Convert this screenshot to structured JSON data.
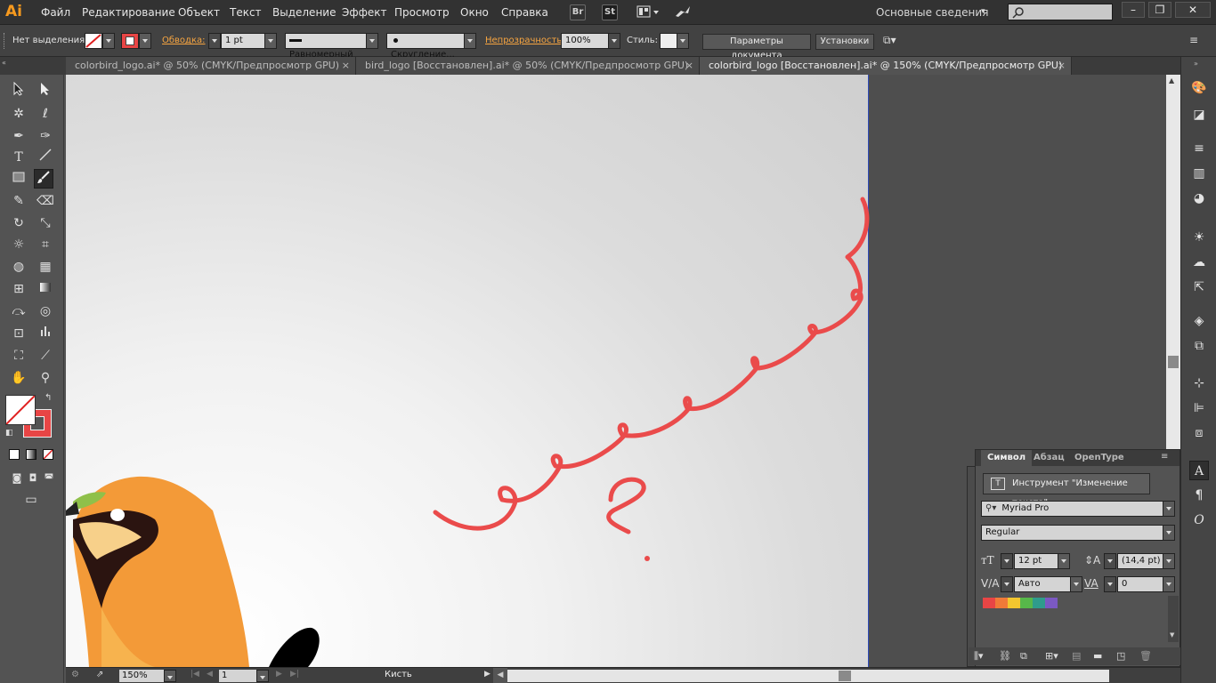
{
  "app": {
    "logo": "Ai"
  },
  "menu": {
    "items": [
      "Файл",
      "Редактирование",
      "Объект",
      "Текст",
      "Выделение",
      "Эффект",
      "Просмотр",
      "Окно",
      "Справка"
    ],
    "bridge_label": "Br",
    "stock_label": "St",
    "workspace": "Основные сведения",
    "search_placeholder": ""
  },
  "controlbar": {
    "selection_label": "Нет выделения",
    "stroke_label": "Обводка:",
    "stroke_value": "1 pt",
    "profile_value": "Равномерный",
    "brush_value": "Скругление...",
    "opacity_label": "Непрозрачность:",
    "opacity_value": "100%",
    "style_label": "Стиль:",
    "doc_setup_label": "Параметры документа",
    "prefs_label": "Установки"
  },
  "tabs": [
    {
      "label": "colorbird_logo.ai* @ 50% (CMYK/Предпросмотр GPU)",
      "active": false
    },
    {
      "label": "bird_logo [Восстановлен].ai* @ 50% (CMYK/Предпросмотр GPU)",
      "active": false
    },
    {
      "label": "colorbird_logo [Восстановлен].ai* @ 150% (CMYK/Предпросмотр GPU)",
      "active": true
    }
  ],
  "tab_close_glyph": "×",
  "status": {
    "zoom": "150%",
    "artboard_number": "1",
    "current_tool": "Кисть"
  },
  "character_panel": {
    "tabs": [
      "Символ",
      "Абзац",
      "OpenType"
    ],
    "touch_tool_label": "Инструмент \"Изменение текста\"",
    "font_family": "Myriad Pro",
    "font_style": "Regular",
    "font_size": "12 pt",
    "leading": "(14,4 pt)",
    "kerning": "Авто",
    "tracking": "0"
  },
  "colors": {
    "accent_orange": "#f79a1e",
    "stroke_red": "#e84545",
    "swatches": [
      "#e84545",
      "#f07a38",
      "#f3c62f",
      "#57b84a",
      "#2f9c8c",
      "#7b59c2"
    ]
  },
  "icons": {
    "tools": [
      "selection-icon",
      "direct-selection-icon",
      "magic-wand-icon",
      "lasso-icon",
      "pen-icon",
      "curvature-icon",
      "type-icon",
      "line-icon",
      "rectangle-icon",
      "paintbrush-icon",
      "pencil-icon",
      "eraser-icon",
      "rotate-icon",
      "scale-icon",
      "warp-icon",
      "free-transform-icon",
      "shape-builder-icon",
      "perspective-icon",
      "mesh-icon",
      "gradient-icon",
      "eyedropper-icon",
      "blend-icon",
      "symbol-sprayer-icon",
      "column-graph-icon",
      "artboard-icon",
      "slice-icon",
      "hand-icon",
      "zoom-icon"
    ]
  }
}
